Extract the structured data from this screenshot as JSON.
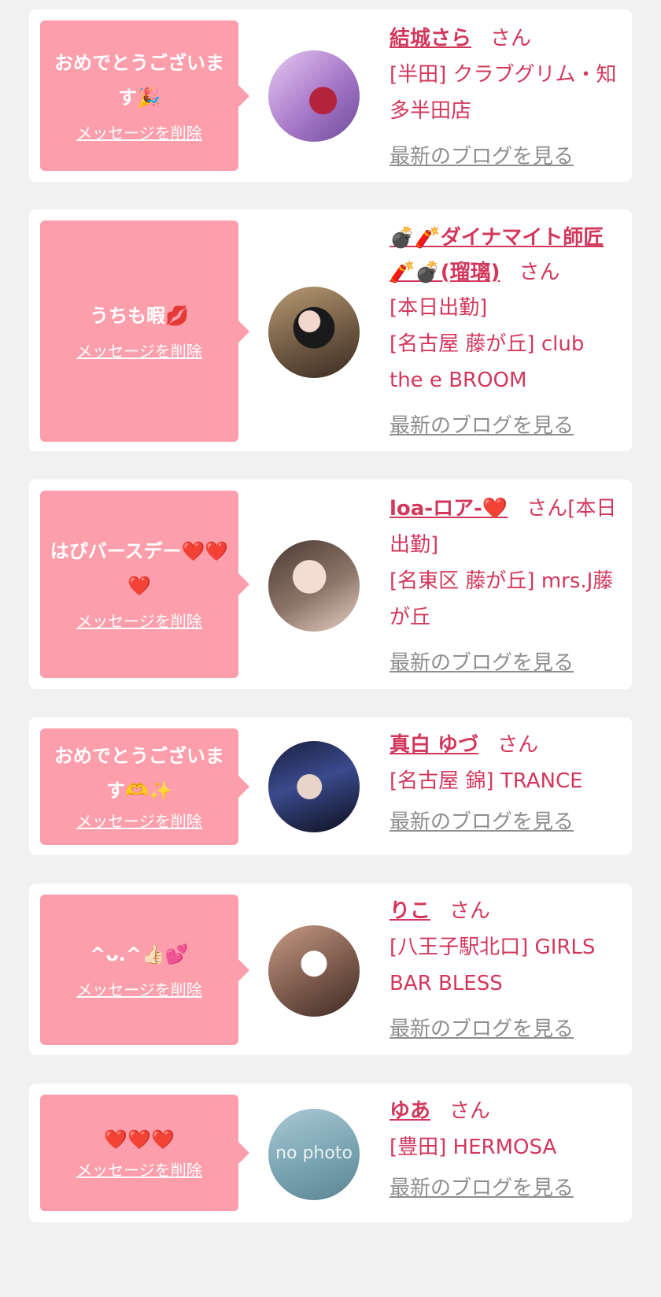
{
  "common": {
    "delete_label": "メッセージを削除",
    "blog_label": "最新のブログを見る",
    "san": "さん"
  },
  "cards": [
    {
      "message": "おめでとうございます",
      "message_emoji": "🎉",
      "name": "結城さら",
      "lines": [
        "[半田] クラブグリム・知多半田店"
      ]
    },
    {
      "message": "うちも暇",
      "message_emoji": "💋",
      "name": "💣🧨ダイナマイト師匠🧨💣(瑠璃)",
      "lines": [
        "[本日出勤]",
        "[名古屋 藤が丘] club the e BROOM"
      ]
    },
    {
      "message": "はぴバースデー",
      "message_emoji": "❤️❤️❤️",
      "name": "loa-ロア-❤️",
      "san_inline": "さん[本日出勤]",
      "lines": [
        "[名東区 藤が丘] mrs.J藤が丘"
      ]
    },
    {
      "message": "おめでとうございます",
      "message_emoji": "🫶✨",
      "name": "真白 ゆづ",
      "lines": [
        "[名古屋 錦] TRANCE"
      ]
    },
    {
      "message": "^ᴗ.^",
      "message_emoji": "👍🏻💕",
      "name": "りこ",
      "lines": [
        "[八王子駅北口] GIRLS BAR BLESS"
      ]
    },
    {
      "message": "",
      "message_emoji": "❤️❤️❤️",
      "name": "ゆあ",
      "lines": [
        "[豊田] HERMOSA"
      ],
      "avatar_text": "no photo"
    }
  ],
  "colors": {
    "accent": "#d2385c",
    "bubble": "#fd9eac",
    "background": "#f1f1f1",
    "link_gray": "#8e8e8e"
  }
}
